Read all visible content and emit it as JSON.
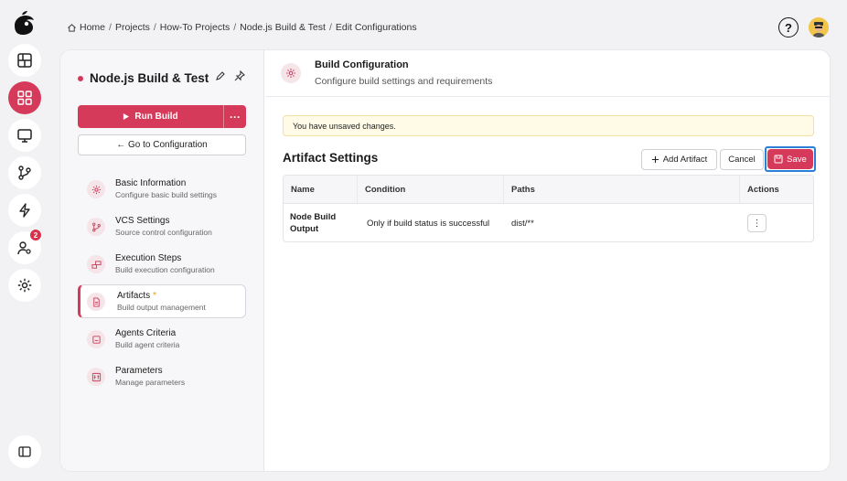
{
  "breadcrumb": {
    "items": [
      "Home",
      "Projects",
      "How-To Projects",
      "Node.js Build & Test",
      "Edit Configurations"
    ],
    "separator": "/"
  },
  "header": {
    "help_label": "?"
  },
  "rail": {
    "items": [
      {
        "icon": "dashboard-icon"
      },
      {
        "icon": "projects-grid-icon",
        "active": true
      },
      {
        "icon": "monitor-icon"
      },
      {
        "icon": "git-branch-icon"
      },
      {
        "icon": "lightning-icon"
      },
      {
        "icon": "user-settings-icon",
        "badge": "2"
      },
      {
        "icon": "gear-icon"
      }
    ],
    "accent": "#d63a5a"
  },
  "sidebar": {
    "project_title": "Node.js Build & Test",
    "run_label": "Run Build",
    "more_label": "···",
    "goto_label": "← Go to Configuration",
    "items": [
      {
        "label": "Basic Information",
        "sub": "Configure basic build settings",
        "icon": "gear-icon"
      },
      {
        "label": "VCS Settings",
        "sub": "Source control configuration",
        "icon": "git-branch-icon"
      },
      {
        "label": "Execution Steps",
        "sub": "Build execution configuration",
        "icon": "steps-icon"
      },
      {
        "label": "Artifacts",
        "sub": "Build output management",
        "icon": "file-icon",
        "active": true,
        "modified": "*"
      },
      {
        "label": "Agents Criteria",
        "sub": "Build agent criteria",
        "icon": "agent-icon"
      },
      {
        "label": "Parameters",
        "sub": "Manage parameters",
        "icon": "parameters-icon"
      }
    ]
  },
  "content": {
    "title": "Build Configuration",
    "subtitle": "Configure build settings and requirements",
    "warning": "You have unsaved changes.",
    "section_title": "Artifact Settings",
    "add_label": "Add Artifact",
    "cancel_label": "Cancel",
    "save_label": "Save",
    "table": {
      "headers": [
        "Name",
        "Condition",
        "Paths",
        "Actions"
      ],
      "rows": [
        {
          "name": "Node Build Output",
          "condition": "Only if build status is successful",
          "paths": "dist/**",
          "action": "⋮"
        }
      ]
    }
  }
}
